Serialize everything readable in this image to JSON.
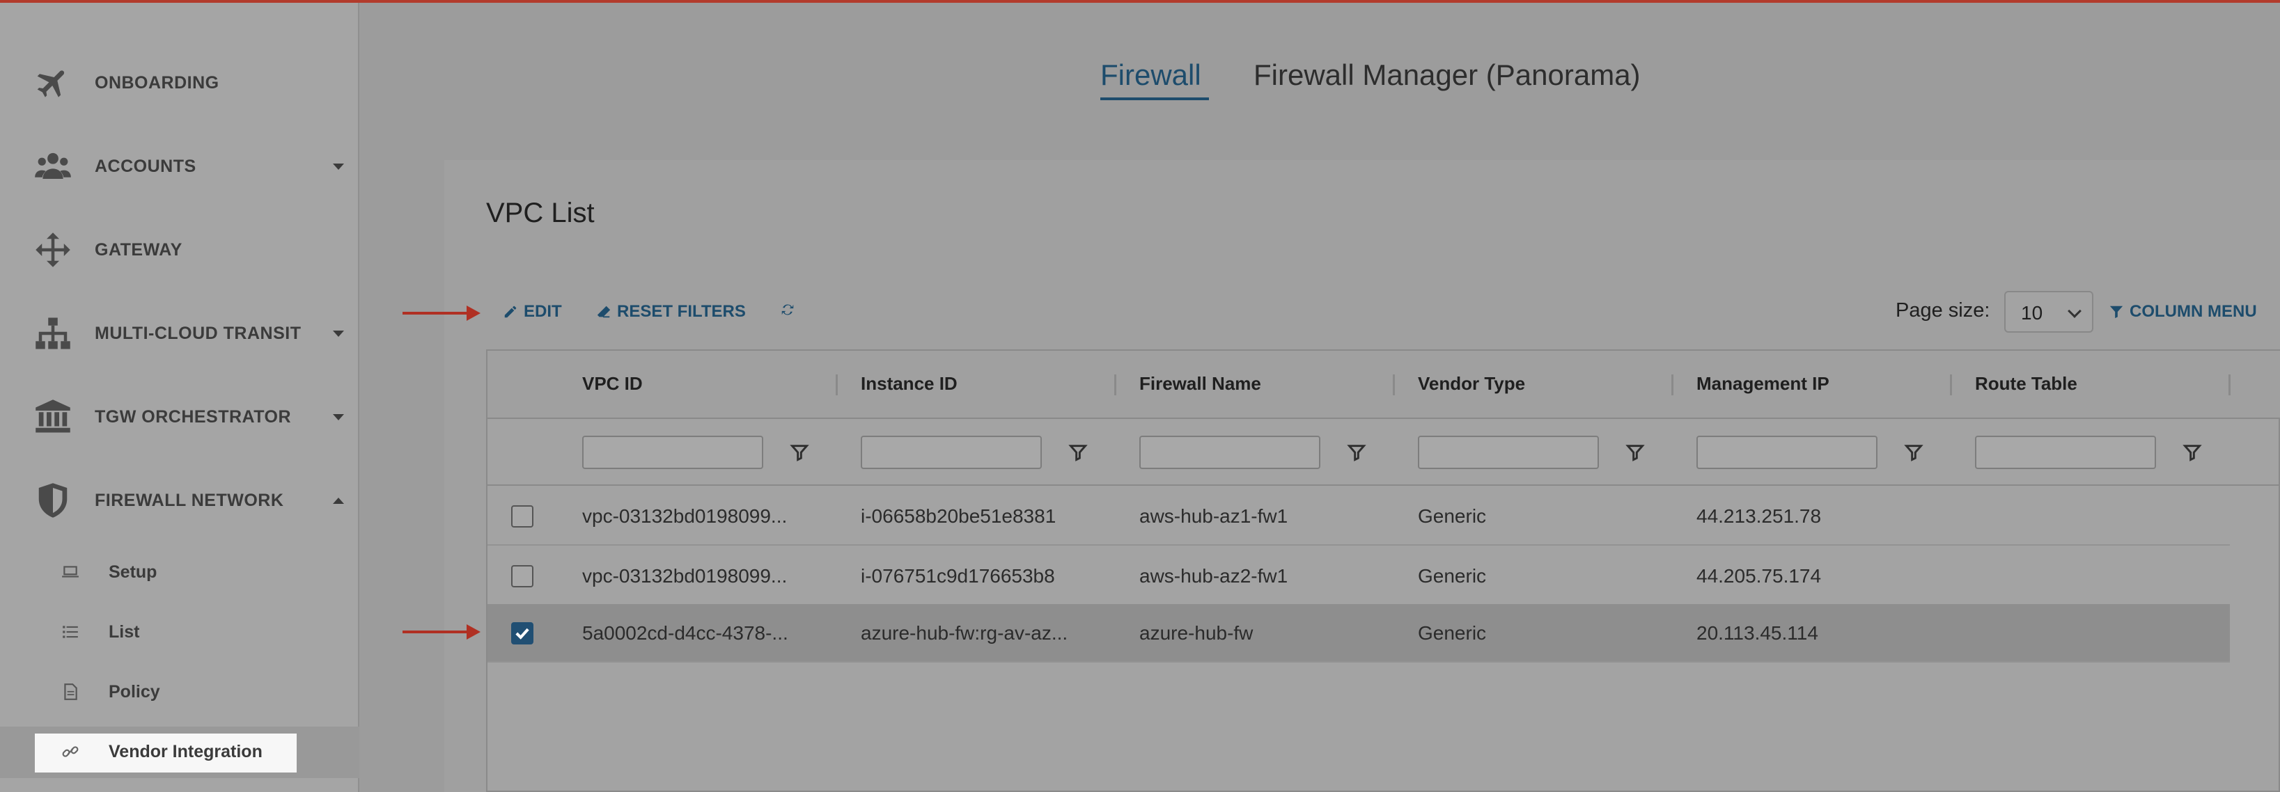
{
  "sidebar": {
    "items": [
      {
        "label": "ONBOARDING",
        "icon": "plane-icon"
      },
      {
        "label": "ACCOUNTS",
        "icon": "users-icon"
      },
      {
        "label": "GATEWAY",
        "icon": "move-arrows-icon"
      },
      {
        "label": "MULTI-CLOUD TRANSIT",
        "icon": "network-icon"
      },
      {
        "label": "TGW ORCHESTRATOR",
        "icon": "bank-icon"
      },
      {
        "label": "FIREWALL NETWORK",
        "icon": "shield-icon"
      }
    ],
    "subitems": [
      {
        "label": "Setup",
        "icon": "laptop-icon"
      },
      {
        "label": "List",
        "icon": "list-icon"
      },
      {
        "label": "Policy",
        "icon": "document-icon"
      },
      {
        "label": "Vendor Integration",
        "icon": "link-icon"
      }
    ]
  },
  "tabs": [
    {
      "label": "Firewall",
      "active": true
    },
    {
      "label": "Firewall Manager (Panorama)",
      "active": false
    }
  ],
  "panel": {
    "title": "VPC List",
    "toolbar": {
      "edit": "EDIT",
      "reset_filters": "RESET FILTERS",
      "refresh_icon": "refresh-icon",
      "page_size_label": "Page size:",
      "page_size_value": "10",
      "column_menu": "COLUMN MENU"
    }
  },
  "table": {
    "columns": [
      "VPC ID",
      "Instance ID",
      "Firewall Name",
      "Vendor Type",
      "Management IP",
      "Route Table"
    ],
    "rows": [
      {
        "checked": false,
        "vpc_id": "vpc-03132bd0198099...",
        "instance_id": "i-06658b20be51e8381",
        "firewall_name": "aws-hub-az1-fw1",
        "vendor_type": "Generic",
        "management_ip": "44.213.251.78",
        "route_table": ""
      },
      {
        "checked": false,
        "vpc_id": "vpc-03132bd0198099...",
        "instance_id": "i-076751c9d176653b8",
        "firewall_name": "aws-hub-az2-fw1",
        "vendor_type": "Generic",
        "management_ip": "44.205.75.174",
        "route_table": ""
      },
      {
        "checked": true,
        "vpc_id": "5a0002cd-d4cc-4378-...",
        "instance_id": "azure-hub-fw:rg-av-az...",
        "firewall_name": "azure-hub-fw",
        "vendor_type": "Generic",
        "management_ip": "20.113.45.114",
        "route_table": ""
      }
    ]
  },
  "colors": {
    "accent": "#1d4c6c",
    "annotation_arrow": "#b03023",
    "top_bar": "#b23b2c"
  }
}
